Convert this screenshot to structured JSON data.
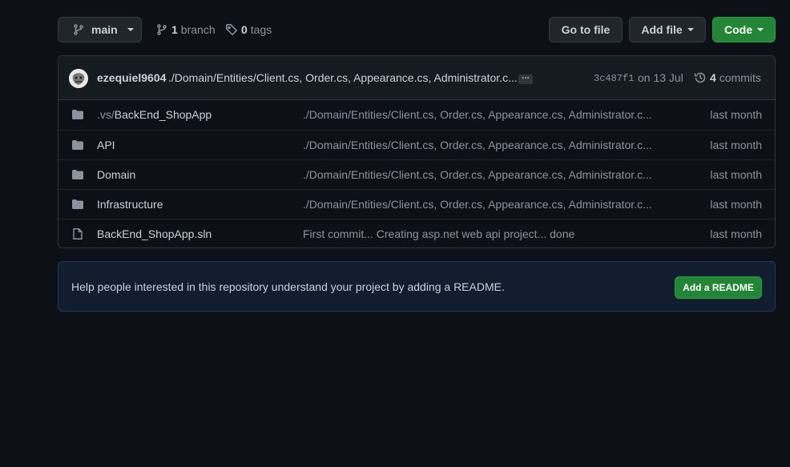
{
  "toolbar": {
    "branch_name": "main",
    "branch_count": "1",
    "branch_label": "branch",
    "tag_count": "0",
    "tag_label": "tags",
    "go_to_file": "Go to file",
    "add_file": "Add file",
    "code": "Code"
  },
  "commit": {
    "author": "ezequiel9604",
    "message": "./Domain/Entities/Client.cs, Order.cs, Appearance.cs, Administrator.c...",
    "ellipsis": "…",
    "sha": "3c487f1",
    "date": "on 13 Jul",
    "commit_count": "4",
    "commit_label": "commits"
  },
  "files": [
    {
      "type": "folder",
      "name_prefix": ".vs/",
      "name": "BackEnd_ShopApp",
      "message": "./Domain/Entities/Client.cs, Order.cs, Appearance.cs, Administrator.c...",
      "age": "last month"
    },
    {
      "type": "folder",
      "name_prefix": "",
      "name": "API",
      "message": "./Domain/Entities/Client.cs, Order.cs, Appearance.cs, Administrator.c...",
      "age": "last month"
    },
    {
      "type": "folder",
      "name_prefix": "",
      "name": "Domain",
      "message": "./Domain/Entities/Client.cs, Order.cs, Appearance.cs, Administrator.c...",
      "age": "last month"
    },
    {
      "type": "folder",
      "name_prefix": "",
      "name": "Infrastructure",
      "message": "./Domain/Entities/Client.cs, Order.cs, Appearance.cs, Administrator.c...",
      "age": "last month"
    },
    {
      "type": "file",
      "name_prefix": "",
      "name": "BackEnd_ShopApp.sln",
      "message": "First commit... Creating asp.net web api project... done",
      "age": "last month"
    }
  ],
  "readme": {
    "text": "Help people interested in this repository understand your project by adding a README.",
    "button": "Add a README"
  },
  "colors": {
    "background": "#0d1117",
    "accent_green": "#238636",
    "folder_icon": "#8b949e"
  }
}
